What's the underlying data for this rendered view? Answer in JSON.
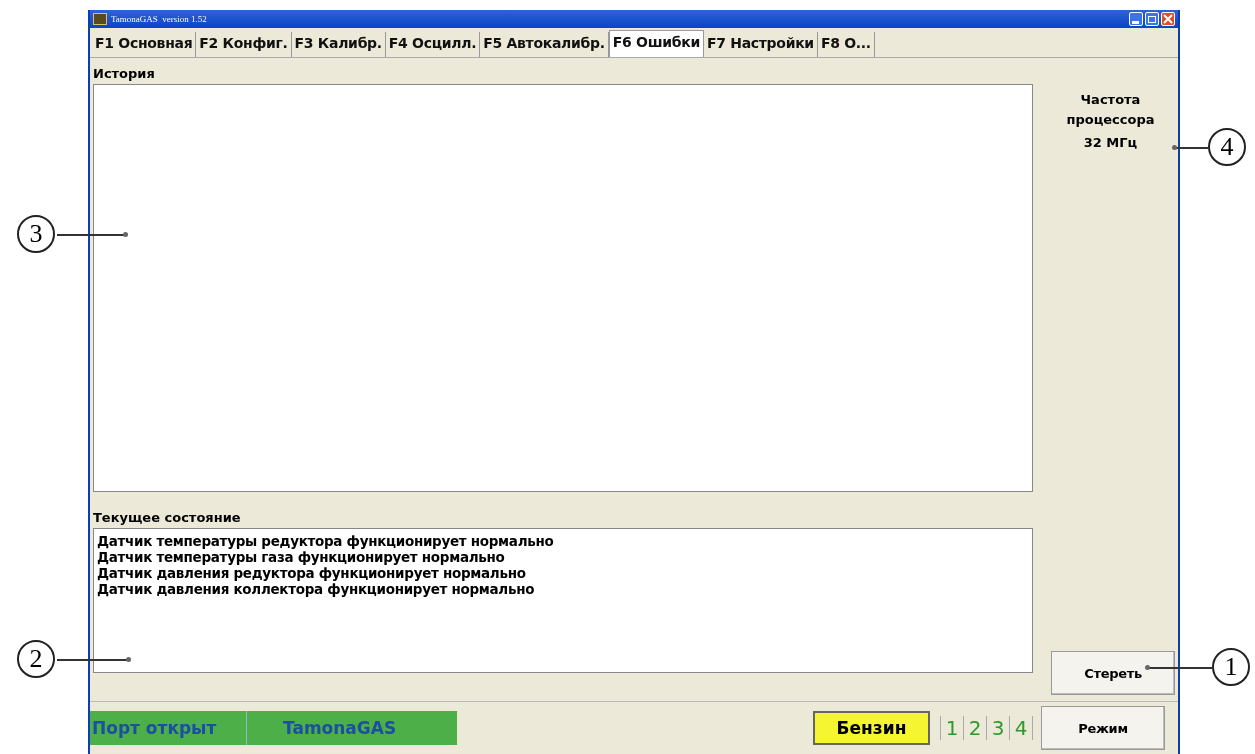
{
  "window": {
    "title": "TamonaGAS  version 1.52"
  },
  "tabs": [
    {
      "label": "F1 Основная",
      "selected": false
    },
    {
      "label": "F2 Конфиг.",
      "selected": false
    },
    {
      "label": "F3 Калибр.",
      "selected": false
    },
    {
      "label": "F4 Осцилл.",
      "selected": false
    },
    {
      "label": "F5 Автокалибр.",
      "selected": false
    },
    {
      "label": "F6 Ошибки",
      "selected": true
    },
    {
      "label": "F7 Настройки",
      "selected": false
    },
    {
      "label": "F8 О...",
      "selected": false
    }
  ],
  "history": {
    "label": "История"
  },
  "cpu": {
    "label": "Частота процессора",
    "value": "32  МГц"
  },
  "current_state": {
    "label": "Текущее состояние",
    "lines": [
      "Датчик температуры редуктора функционирует нормально",
      "Датчик температуры газа функционирует нормально",
      "Датчик давления редуктора функционирует нормально",
      "Датчик давления коллектора функционирует нормально"
    ]
  },
  "clear_button": "Стереть",
  "status_bar": {
    "port": "Порт открыт",
    "app": "TamonaGAS",
    "fuel": "Бензин",
    "cylinders": [
      "1",
      "2",
      "3",
      "4"
    ],
    "mode_button": "Режим"
  },
  "callouts": [
    {
      "number": "4",
      "kind": "right"
    },
    {
      "number": "3",
      "kind": "left"
    },
    {
      "number": "2",
      "kind": "left"
    },
    {
      "number": "1",
      "kind": "right"
    }
  ]
}
